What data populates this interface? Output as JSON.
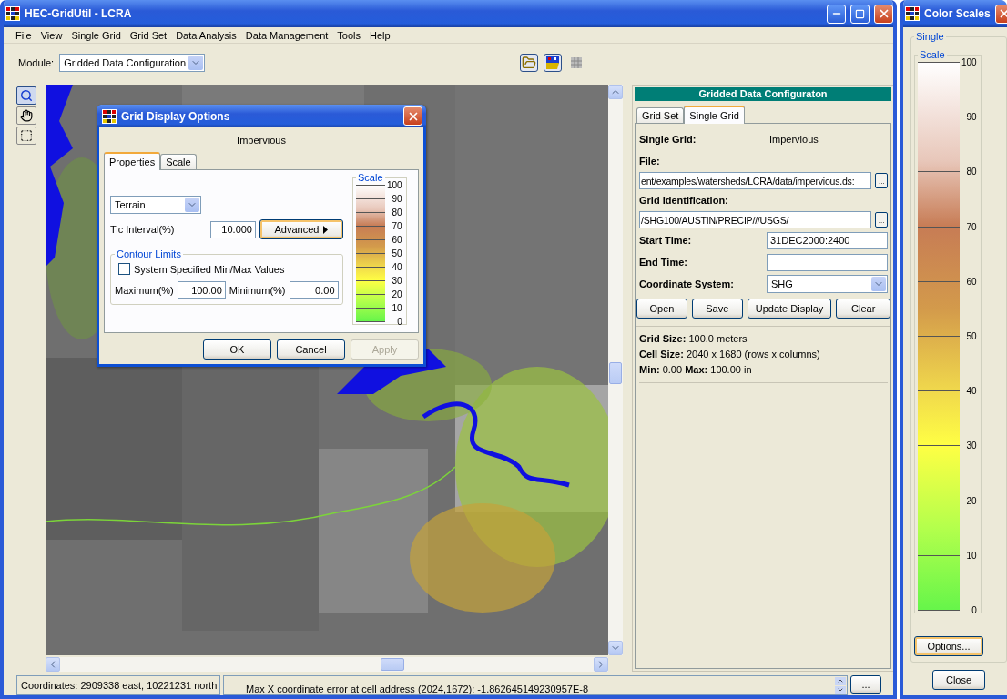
{
  "window": {
    "title": "HEC-GridUtil - LCRA"
  },
  "menu": [
    "File",
    "View",
    "Single Grid",
    "Grid Set",
    "Data Analysis",
    "Data Management",
    "Tools",
    "Help"
  ],
  "module": {
    "label": "Module:",
    "value": "Gridded Data Configuration"
  },
  "dialog": {
    "title": "Grid Display Options",
    "grid_name": "Impervious",
    "tabs": [
      {
        "label": "Properties",
        "selected": true
      },
      {
        "label": "Scale",
        "selected": false
      }
    ],
    "scheme": "Terrain",
    "tic_label": "Tic Interval(%)",
    "tic_value": "10.000",
    "advanced": "Advanced",
    "contour": {
      "title": "Contour Limits",
      "checkbox": {
        "label": "System Specified Min/Max Values",
        "checked": false
      },
      "max_label": "Maximum(%)",
      "max_value": "100.00",
      "min_label": "Minimum(%)",
      "min_value": "0.00"
    },
    "scale": {
      "title": "Scale",
      "labels": [
        "100",
        "90",
        "80",
        "70",
        "60",
        "50",
        "40",
        "30",
        "20",
        "10",
        "0"
      ]
    },
    "buttons": [
      {
        "label": "OK",
        "disabled": false
      },
      {
        "label": "Cancel",
        "disabled": false
      },
      {
        "label": "Apply",
        "disabled": true
      }
    ]
  },
  "panel": {
    "header": "Gridded Data Configuraton",
    "tabs": [
      {
        "label": "Grid Set",
        "selected": false
      },
      {
        "label": "Single Grid",
        "selected": true
      }
    ],
    "single_grid": {
      "label": "Single Grid:",
      "value": "Impervious"
    },
    "file": {
      "label": "File:",
      "value": "ent/examples/watersheds/LCRA/data/impervious.ds:",
      "browse": "..."
    },
    "grid_id": {
      "label": "Grid Identification:",
      "value": "/SHG100/AUSTIN/PRECIP///USGS/",
      "browse": "..."
    },
    "start_time": {
      "label": "Start Time:",
      "value": "31DEC2000:2400"
    },
    "end_time": {
      "label": "End Time:"
    },
    "coordinate_system": {
      "label": "Coordinate System:",
      "value": "SHG"
    },
    "buttons": [
      "Open",
      "Save",
      "Update Display",
      "Clear"
    ],
    "info": [
      "**Grid Size:** 100.0 meters",
      "**Cell Size:** 2040 x 1680 (rows x columns)",
      "**Min:** 0.00 **Max:** 100.00 in"
    ]
  },
  "status_bar": {
    "coordinates": "Coordinates: 2909338 east, 10221231 north",
    "message": "Max X coordinate error at cell address (2024,1672): -1.862645149230957E-8",
    "button": "..."
  },
  "color_scales": {
    "title": "Color Scales",
    "group": "Single",
    "scale": {
      "title": "Scale",
      "labels": [
        "100",
        "90",
        "80",
        "70",
        "60",
        "50",
        "40",
        "30",
        "20",
        "10",
        "0"
      ]
    },
    "options": "Options...",
    "close": "Close"
  }
}
